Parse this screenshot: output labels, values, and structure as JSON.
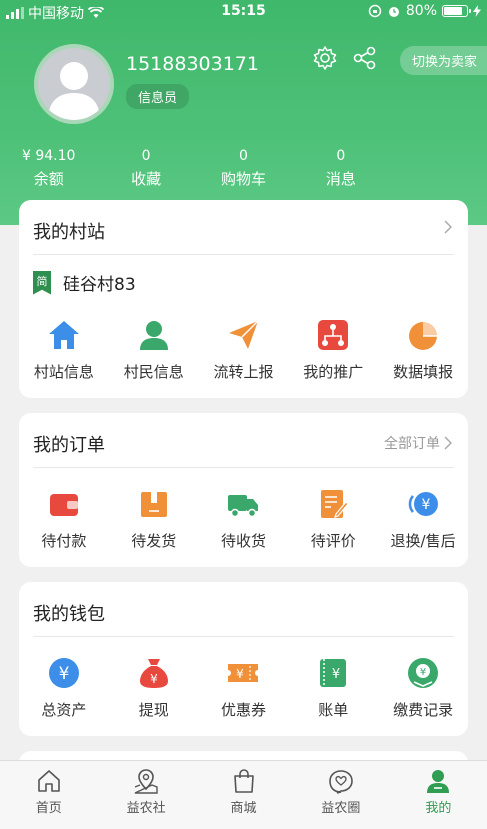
{
  "status_bar": {
    "carrier": "中国移动",
    "time": "15:15",
    "battery": "80%",
    "battery_level": 0.8
  },
  "profile": {
    "phone": "15188303171",
    "role": "信息员",
    "switch_label": "切换为卖家"
  },
  "stats": [
    {
      "value": "¥ 94.10",
      "label": "余额"
    },
    {
      "value": "0",
      "label": "收藏"
    },
    {
      "value": "0",
      "label": "购物车"
    },
    {
      "value": "0",
      "label": "消息"
    }
  ],
  "station_card": {
    "title": "我的村站",
    "badge": "简",
    "station_name": "硅谷村83",
    "items": [
      {
        "label": "村站信息",
        "icon": "home-icon",
        "color": "#3d8ee8"
      },
      {
        "label": "村民信息",
        "icon": "person-icon",
        "color": "#39a86a"
      },
      {
        "label": "流转上报",
        "icon": "paper-plane-icon",
        "color": "#f0913a"
      },
      {
        "label": "我的推广",
        "icon": "hierarchy-icon",
        "color": "#e8493f"
      },
      {
        "label": "数据填报",
        "icon": "pie-chart-icon",
        "color": "#f0913a"
      }
    ]
  },
  "order_card": {
    "title": "我的订单",
    "more": "全部订单",
    "items": [
      {
        "label": "待付款",
        "icon": "wallet-icon",
        "color": "#e8493f"
      },
      {
        "label": "待发货",
        "icon": "package-icon",
        "color": "#f0913a"
      },
      {
        "label": "待收货",
        "icon": "truck-icon",
        "color": "#39a86a"
      },
      {
        "label": "待评价",
        "icon": "edit-note-icon",
        "color": "#f0913a"
      },
      {
        "label": "退换/售后",
        "icon": "refund-icon",
        "color": "#3d8ee8"
      }
    ]
  },
  "wallet_card": {
    "title": "我的钱包",
    "items": [
      {
        "label": "总资产",
        "icon": "yen-circle-icon",
        "color": "#3d8ee8"
      },
      {
        "label": "提现",
        "icon": "money-bag-icon",
        "color": "#e8493f"
      },
      {
        "label": "优惠券",
        "icon": "coupon-icon",
        "color": "#f0913a"
      },
      {
        "label": "账单",
        "icon": "bill-icon",
        "color": "#39a86a"
      },
      {
        "label": "缴费记录",
        "icon": "payment-record-icon",
        "color": "#39a86a"
      }
    ]
  },
  "tabbar": [
    {
      "label": "首页",
      "icon": "home-outline-icon",
      "active": false
    },
    {
      "label": "益农社",
      "icon": "map-pin-icon",
      "active": false
    },
    {
      "label": "商城",
      "icon": "shopping-bag-icon",
      "active": false
    },
    {
      "label": "益农圈",
      "icon": "heart-chat-icon",
      "active": false
    },
    {
      "label": "我的",
      "icon": "user-icon",
      "active": true
    }
  ],
  "colors": {
    "brand_green": "#4ec178",
    "active_tab": "#2f9d52"
  }
}
